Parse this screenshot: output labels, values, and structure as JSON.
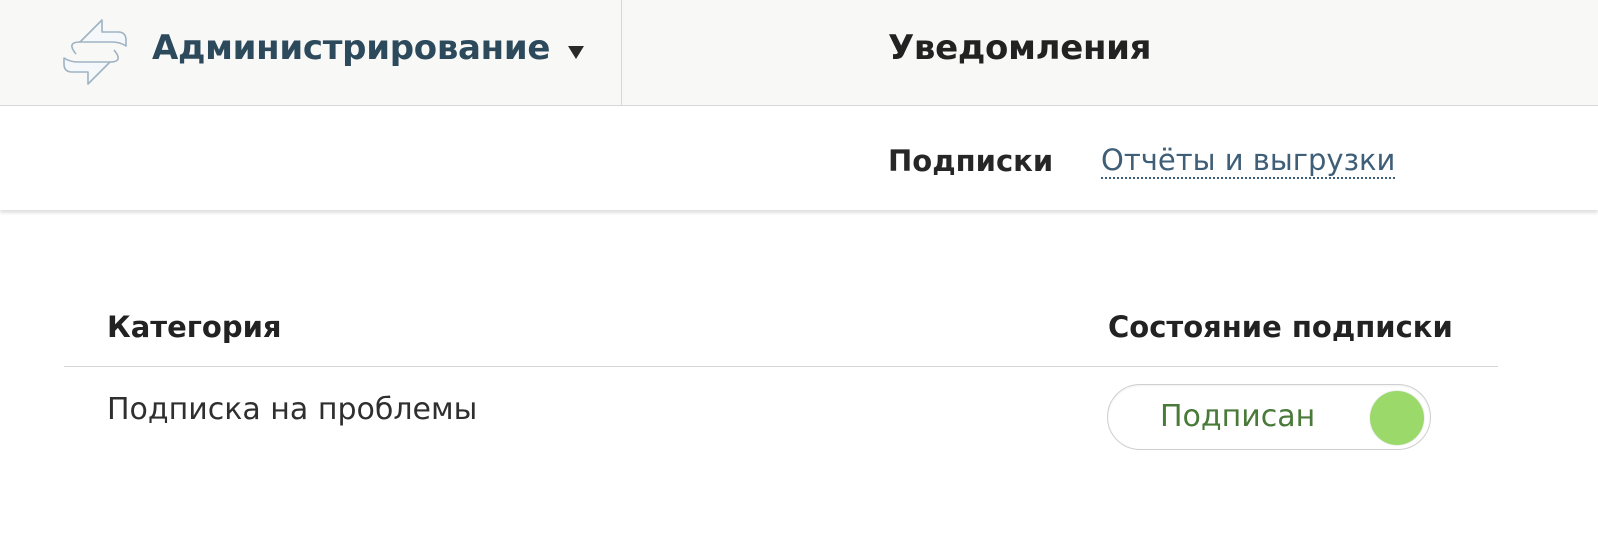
{
  "header": {
    "module_title": "Администрирование",
    "page_title": "Уведомления",
    "logo_icon": "arrows-cycle-logo-icon",
    "caret_icon": "triangle-down-icon"
  },
  "subnav": {
    "tabs": [
      {
        "label": "Подписки",
        "active": true
      },
      {
        "label": "Отчёты и выгрузки",
        "active": false
      }
    ]
  },
  "table": {
    "columns": [
      "Категория",
      "Состояние подписки"
    ],
    "rows": [
      {
        "category": "Подписка на проблемы",
        "status_label": "Подписан",
        "subscribed": true
      }
    ]
  },
  "colors": {
    "module_title": "#2d4a5c",
    "link": "#3f5e77",
    "toggle_on": "#9ad96a",
    "toggle_text": "#4a7a3a"
  }
}
